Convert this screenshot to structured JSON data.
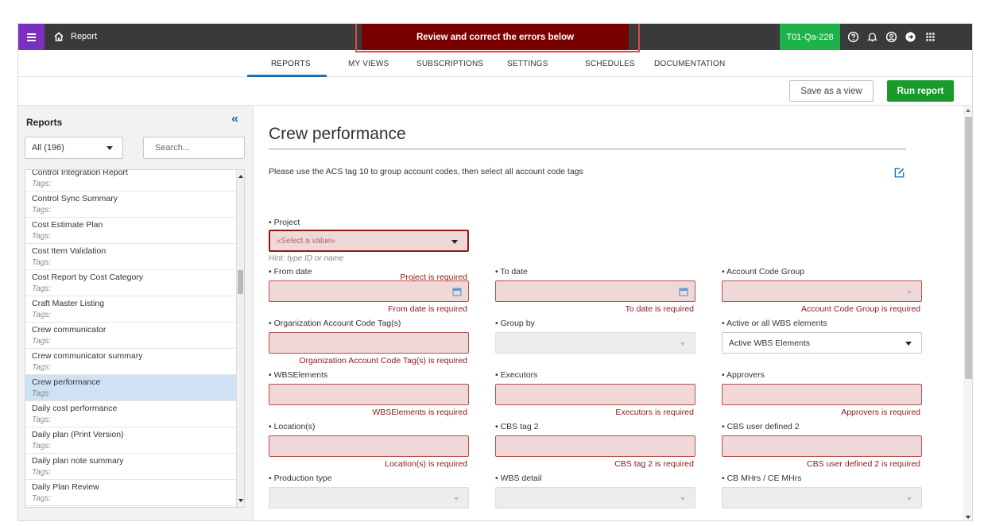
{
  "topbar": {
    "app_title": "Report",
    "error_banner": "Review and correct the errors below",
    "environment": "T01-Qa-228"
  },
  "tabs": [
    {
      "label": "REPORTS"
    },
    {
      "label": "MY VIEWS"
    },
    {
      "label": "SUBSCRIPTIONS"
    },
    {
      "label": "SETTINGS"
    },
    {
      "label": "SCHEDULES"
    },
    {
      "label": "DOCUMENTATION"
    }
  ],
  "actions": {
    "save_view": "Save as a view",
    "run_report": "Run report"
  },
  "sidebar": {
    "title": "Reports",
    "collapse_glyph": "«",
    "filter_value": "All (196)",
    "search_placeholder": "Search...",
    "items": [
      {
        "name": "Control Integration Report",
        "tags": "Tags:"
      },
      {
        "name": "Control Sync Summary",
        "tags": "Tags:"
      },
      {
        "name": "Cost Estimate Plan",
        "tags": "Tags:"
      },
      {
        "name": "Cost Item Validation",
        "tags": "Tags:"
      },
      {
        "name": "Cost Report by Cost Category",
        "tags": "Tags:"
      },
      {
        "name": "Craft Master Listing",
        "tags": "Tags:"
      },
      {
        "name": "Crew communicator",
        "tags": "Tags:"
      },
      {
        "name": "Crew communicator summary",
        "tags": "Tags:"
      },
      {
        "name": "Crew performance",
        "tags": "Tags:",
        "selected": true
      },
      {
        "name": "Daily cost performance",
        "tags": "Tags:"
      },
      {
        "name": "Daily plan (Print Version)",
        "tags": "Tags:"
      },
      {
        "name": "Daily plan note summary",
        "tags": "Tags:"
      },
      {
        "name": "Daily Plan Review",
        "tags": "Tags:"
      }
    ]
  },
  "main": {
    "title": "Crew performance",
    "description": "Please use the ACS tag 10 to group account codes, then select all account code tags",
    "project": {
      "label": "• Project",
      "placeholder": "«Select a value»",
      "hint": "Hint: type ID or name",
      "error": "Project is required"
    },
    "from_date": {
      "label": "• From date",
      "error": "From date is required"
    },
    "to_date": {
      "label": "• To date",
      "error": "To date is required"
    },
    "account_code_group": {
      "label": "• Account Code Group",
      "error": "Account Code Group is required"
    },
    "org_account_code_tags": {
      "label": "• Organization Account Code Tag(s)",
      "error": "Organization Account Code Tag(s) is required"
    },
    "group_by": {
      "label": "• Group by"
    },
    "active_or_all_wbs": {
      "label": "• Active or all WBS elements",
      "value": "Active WBS Elements"
    },
    "wbs_elements": {
      "label": "• WBSElements",
      "error": "WBSElements is required"
    },
    "executors": {
      "label": "• Executors",
      "error": "Executors is required"
    },
    "approvers": {
      "label": "• Approvers",
      "error": "Approvers is required"
    },
    "locations": {
      "label": "• Location(s)",
      "error": "Location(s) is required"
    },
    "cbs_tag_2": {
      "label": "• CBS tag 2",
      "error": "CBS tag 2 is required"
    },
    "cbs_user_defined_2": {
      "label": "• CBS user defined 2",
      "error": "CBS user defined 2 is required"
    },
    "production_type": {
      "label": "• Production type"
    },
    "wbs_detail": {
      "label": "• WBS detail"
    },
    "cb_mhrs": {
      "label": "• CB MHrs / CE MHrs"
    }
  },
  "colors": {
    "menu_purple": "#7b2fbe",
    "error_banner": "#7a0000",
    "env_badge_green": "#1eb24a",
    "run_button_green": "#1a9a2b",
    "error_text": "#8b1a1a",
    "error_field_bg": "#f0d8d8",
    "selected_row": "#cfe2f5",
    "accent_blue": "#1a73b8"
  },
  "icons": [
    "menu-icon",
    "home-icon",
    "help-icon",
    "bell-icon",
    "user-icon",
    "logout-icon",
    "apps-grid-icon",
    "calendar-icon",
    "edit-icon"
  ]
}
